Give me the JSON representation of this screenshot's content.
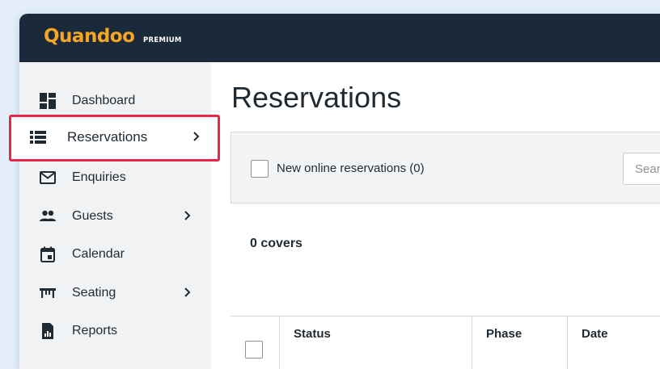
{
  "brand": {
    "name": "Quandoo",
    "tag": "PREMIUM"
  },
  "sidebar": {
    "items": [
      {
        "label": "Dashboard",
        "icon": "dashboard-icon",
        "has_chevron": false
      },
      {
        "label": "Reservations",
        "icon": "list-icon",
        "has_chevron": true,
        "active": true
      },
      {
        "label": "Enquiries",
        "icon": "envelope-icon",
        "has_chevron": false
      },
      {
        "label": "Guests",
        "icon": "people-icon",
        "has_chevron": true
      },
      {
        "label": "Calendar",
        "icon": "calendar-icon",
        "has_chevron": false
      },
      {
        "label": "Seating",
        "icon": "table-icon",
        "has_chevron": true
      },
      {
        "label": "Reports",
        "icon": "report-icon",
        "has_chevron": false
      }
    ]
  },
  "main": {
    "title": "Reservations",
    "filter": {
      "new_online_label": "New online reservations (0)",
      "search_placeholder": "Search"
    },
    "covers": "0 covers",
    "table": {
      "columns": [
        "Status",
        "Phase",
        "Date"
      ]
    }
  },
  "colors": {
    "topbar": "#1b2a3a",
    "brand": "#f5a623",
    "highlight": "#e8254a",
    "sidebar": "#f1f2f4"
  }
}
